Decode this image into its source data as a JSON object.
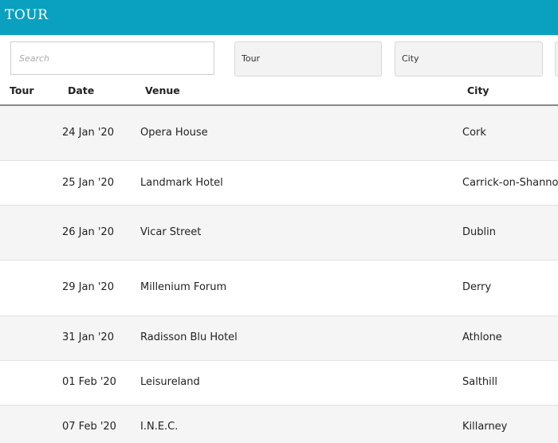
{
  "header": {
    "title": "TOUR"
  },
  "filters": {
    "search_placeholder": "Search",
    "tour_label": "Tour",
    "city_label": "City"
  },
  "table": {
    "columns": [
      "Tour",
      "Date",
      "Venue",
      "City"
    ],
    "rows": [
      {
        "tour": "",
        "date": "24 Jan '20",
        "venue": "Opera House",
        "city": "Cork"
      },
      {
        "tour": "",
        "date": "25 Jan '20",
        "venue": "Landmark Hotel",
        "city": "Carrick-on-Shannon"
      },
      {
        "tour": "",
        "date": "26 Jan '20",
        "venue": "Vicar Street",
        "city": "Dublin"
      },
      {
        "tour": "",
        "date": "29 Jan '20",
        "venue": "Millenium Forum",
        "city": "Derry"
      },
      {
        "tour": "",
        "date": "31 Jan '20",
        "venue": "Radisson Blu Hotel",
        "city": "Athlone"
      },
      {
        "tour": "",
        "date": "01 Feb '20",
        "venue": "Leisureland",
        "city": "Salthill"
      },
      {
        "tour": "",
        "date": "07 Feb '20",
        "venue": "I.N.E.C.",
        "city": "Killarney"
      }
    ]
  },
  "colors": {
    "header_bg": "#0aa1c0",
    "row_alt_bg": "#f5f5f5"
  }
}
